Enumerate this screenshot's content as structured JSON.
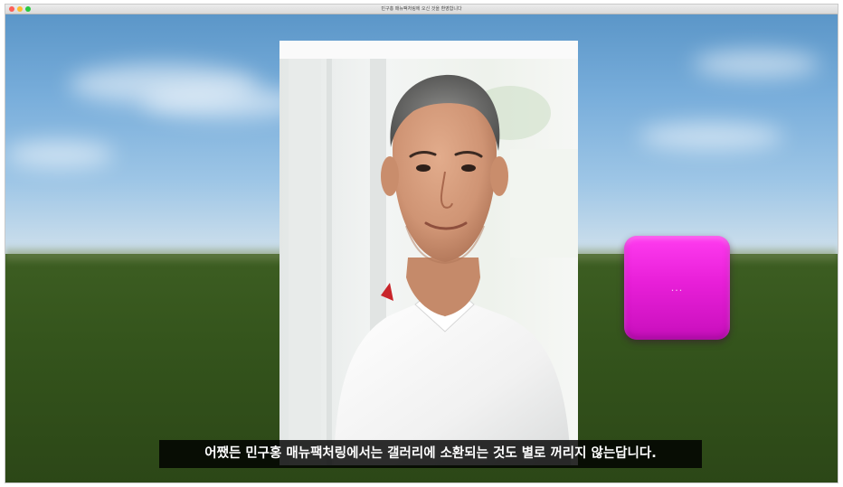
{
  "window": {
    "title": "민구홍 매뉴팩처링에 오신 것을 환영합니다"
  },
  "tile": {
    "label": "...",
    "color": "#e81fd8"
  },
  "subtitle": {
    "text": "어쨌든 민구홍 매뉴팩처링에서는 갤러리에 소환되는 것도 별로 꺼리지 않는답니다."
  },
  "colors": {
    "sky": "#79aedb",
    "ground": "#34541c",
    "subtitle_bg": "#000000"
  }
}
